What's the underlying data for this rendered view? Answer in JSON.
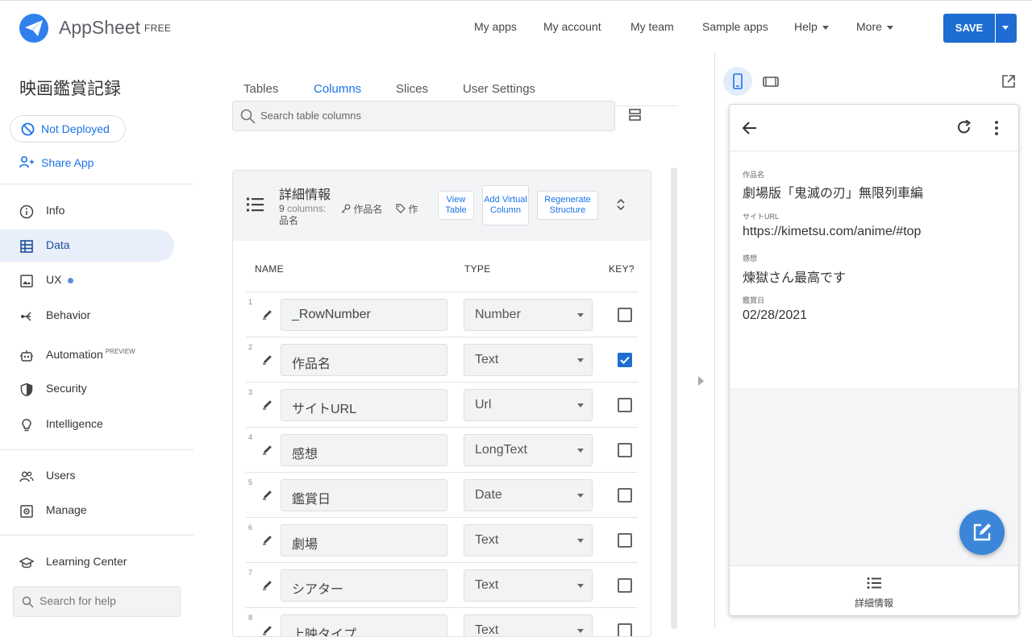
{
  "header": {
    "brand": "AppSheet",
    "plan": "FREE",
    "nav": [
      "My apps",
      "My account",
      "My team",
      "Sample apps",
      "Help",
      "More"
    ],
    "save_label": "SAVE"
  },
  "sidebar": {
    "app_name": "映画鑑賞記録",
    "deploy_status": "Not Deployed",
    "share_label": "Share App",
    "items": [
      {
        "label": "Info"
      },
      {
        "label": "Data"
      },
      {
        "label": "UX"
      },
      {
        "label": "Behavior"
      },
      {
        "label": "Automation",
        "tag": "PREVIEW"
      },
      {
        "label": "Security"
      },
      {
        "label": "Intelligence"
      },
      {
        "label": "Users"
      },
      {
        "label": "Manage"
      },
      {
        "label": "Learning Center"
      }
    ],
    "help_search_placeholder": "Search for help"
  },
  "main": {
    "tabs": [
      "Tables",
      "Columns",
      "Slices",
      "User Settings"
    ],
    "active_tab": "Columns",
    "search_placeholder": "Search table columns",
    "table": {
      "name": "詳細情報",
      "col_count_num": "9",
      "col_count_word": "columns:",
      "col_count_tail": "品名",
      "key_label": "作品名",
      "label_label": "作",
      "view_btn": "View Table",
      "add_virtual_btn": "Add Virtual Column",
      "regenerate_btn": "Regenerate Structure",
      "headers": {
        "name": "NAME",
        "type": "TYPE",
        "key": "KEY?"
      },
      "columns": [
        {
          "num": "1",
          "name": "_RowNumber",
          "type": "Number",
          "key": false
        },
        {
          "num": "2",
          "name": "作品名",
          "type": "Text",
          "key": true
        },
        {
          "num": "3",
          "name": "サイトURL",
          "type": "Url",
          "key": false
        },
        {
          "num": "4",
          "name": "感想",
          "type": "LongText",
          "key": false
        },
        {
          "num": "5",
          "name": "鑑賞日",
          "type": "Date",
          "key": false
        },
        {
          "num": "6",
          "name": "劇場",
          "type": "Text",
          "key": false
        },
        {
          "num": "7",
          "name": "シアター",
          "type": "Text",
          "key": false
        },
        {
          "num": "8",
          "name": "上映タイプ",
          "type": "Text",
          "key": false
        }
      ]
    }
  },
  "preview": {
    "fields": [
      {
        "label": "作品名",
        "value": "劇場版「鬼滅の刃」無限列車編"
      },
      {
        "label": "サイトURL",
        "value": "https://kimetsu.com/anime/#top"
      },
      {
        "label": "感想",
        "value": "煉獄さん最高です"
      },
      {
        "label": "鑑賞日",
        "value": "02/28/2021"
      }
    ],
    "bottom_nav_label": "詳細情報"
  },
  "colors": {
    "accent": "#1a73e8",
    "save": "#1e6dd2",
    "fab": "#3b86d8",
    "active_nav_bg": "#e8eefa"
  }
}
